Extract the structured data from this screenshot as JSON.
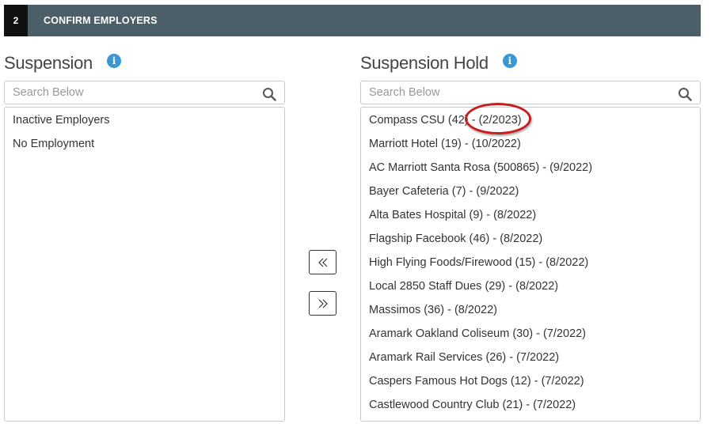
{
  "step": {
    "number": "2",
    "title": "CONFIRM EMPLOYERS"
  },
  "left_panel": {
    "title": "Suspension",
    "search_placeholder": "Search Below",
    "items": [
      {
        "label": "Inactive Employers"
      },
      {
        "label": "No Employment"
      }
    ]
  },
  "right_panel": {
    "title": "Suspension Hold",
    "search_placeholder": "Search Below",
    "items": [
      {
        "label": "Compass CSU (42) - (2/2023)"
      },
      {
        "label": "Marriott Hotel (19) - (10/2022)"
      },
      {
        "label": "AC Marriott Santa Rosa (500865) - (9/2022)"
      },
      {
        "label": "Bayer Cafeteria (7) - (9/2022)"
      },
      {
        "label": "Alta Bates Hospital (9) - (8/2022)"
      },
      {
        "label": "Flagship Facebook (46) - (8/2022)"
      },
      {
        "label": "High Flying Foods/Firewood (15) - (8/2022)"
      },
      {
        "label": "Local 2850 Staff Dues (29) - (8/2022)"
      },
      {
        "label": "Massimos (36) - (8/2022)"
      },
      {
        "label": "Aramark Oakland Coliseum (30) - (7/2022)"
      },
      {
        "label": "Aramark Rail Services (26) - (7/2022)"
      },
      {
        "label": "Caspers Famous Hot Dogs (12) - (7/2022)"
      },
      {
        "label": "Castlewood Country Club (21) - (7/2022)"
      }
    ]
  },
  "icons": {
    "info": "info-icon",
    "search": "search-icon",
    "move_left": "double-chevron-left-icon",
    "move_right": "double-chevron-right-icon"
  },
  "colors": {
    "header_bg": "#4c5f69",
    "step_num_bg": "#111111",
    "info_blue": "#3a98d6",
    "annotation_red": "#c81d1d"
  }
}
